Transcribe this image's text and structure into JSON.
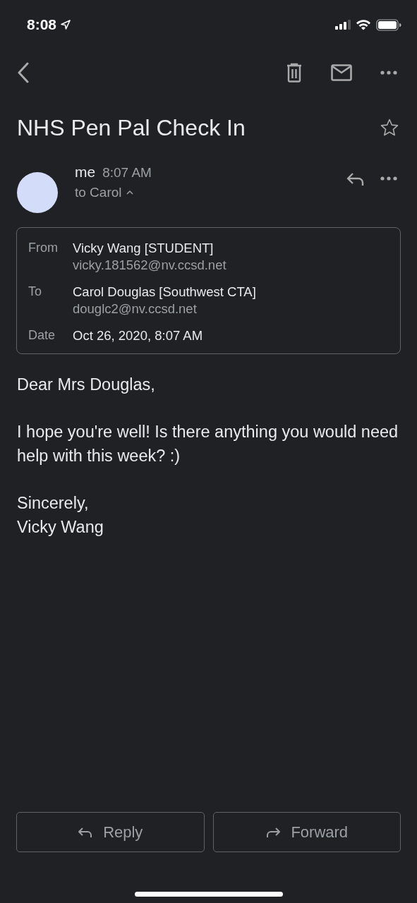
{
  "status_bar": {
    "time": "8:08"
  },
  "subject": "NHS Pen Pal Check In",
  "starred": false,
  "message": {
    "sender": "me",
    "time": "8:07 AM",
    "recipients": "to Carol",
    "details_expanded": true
  },
  "details": [
    {
      "label": "From",
      "name": "Vicky Wang [STUDENT]",
      "email": "vicky.181562@nv.ccsd.net"
    },
    {
      "label": "To",
      "name": "Carol Douglas [Southwest CTA]",
      "email": "douglc2@nv.ccsd.net"
    },
    {
      "label": "Date",
      "name": "Oct 26, 2020, 8:07 AM"
    }
  ],
  "body": [
    [
      "Dear Mrs Douglas,"
    ],
    [
      "I hope you're well! Is there anything you would need help with this week? :)"
    ],
    [
      "Sincerely,",
      "Vicky Wang"
    ]
  ],
  "actions": [
    {
      "kind": "reply",
      "label": "Reply"
    },
    {
      "kind": "forward",
      "label": "Forward"
    }
  ]
}
